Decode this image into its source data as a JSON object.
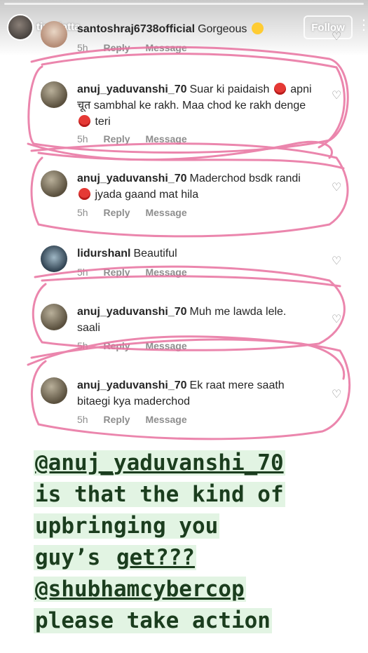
{
  "story": {
    "username": "tinadatta",
    "follow_label": "Follow",
    "more_icon": "more-options-icon"
  },
  "comments": [
    {
      "username": "santoshraj6738official",
      "text": "Gorgeous",
      "emoji": "heart-eyes-emoji",
      "time": "5h",
      "reply": "Reply",
      "message": "Message"
    },
    {
      "username": "anuj_yaduvanshi_70",
      "text_a": "Suar ki paidaish",
      "text_b": "apni चूत sambhal ke rakh. Maa chod ke rakh denge",
      "text_c": "teri",
      "time": "5h",
      "reply": "Reply",
      "message": "Message"
    },
    {
      "username": "anuj_yaduvanshi_70",
      "text_a": "Maderchod bsdk randi",
      "text_b": "jyada gaand mat hila",
      "time": "5h",
      "reply": "Reply",
      "message": "Message"
    },
    {
      "username": "lidurshanl",
      "text": "Beautiful",
      "time": "5h",
      "reply": "Reply",
      "message": "Message"
    },
    {
      "username": "anuj_yaduvanshi_70",
      "text": "Muh me lawda lele. saali",
      "time": "5h",
      "reply": "Reply",
      "message": "Message"
    },
    {
      "username": "anuj_yaduvanshi_70",
      "text": "Ek raat mere saath bitaegi kya maderchod",
      "time": "5h",
      "reply": "Reply",
      "message": "Message"
    }
  ],
  "caption": {
    "mention1": "@anuj_yaduvanshi_70",
    "line2": "is that the kind of",
    "line3": "upbringing you",
    "line4a": "guy’s ",
    "line4b": "get???",
    "mention2": "@shubhamcybercop",
    "line6": "please take action"
  },
  "colors": {
    "highlight": "#e2f4e3",
    "caption_text": "#1b3d1e",
    "scribble": "#e8719f"
  }
}
